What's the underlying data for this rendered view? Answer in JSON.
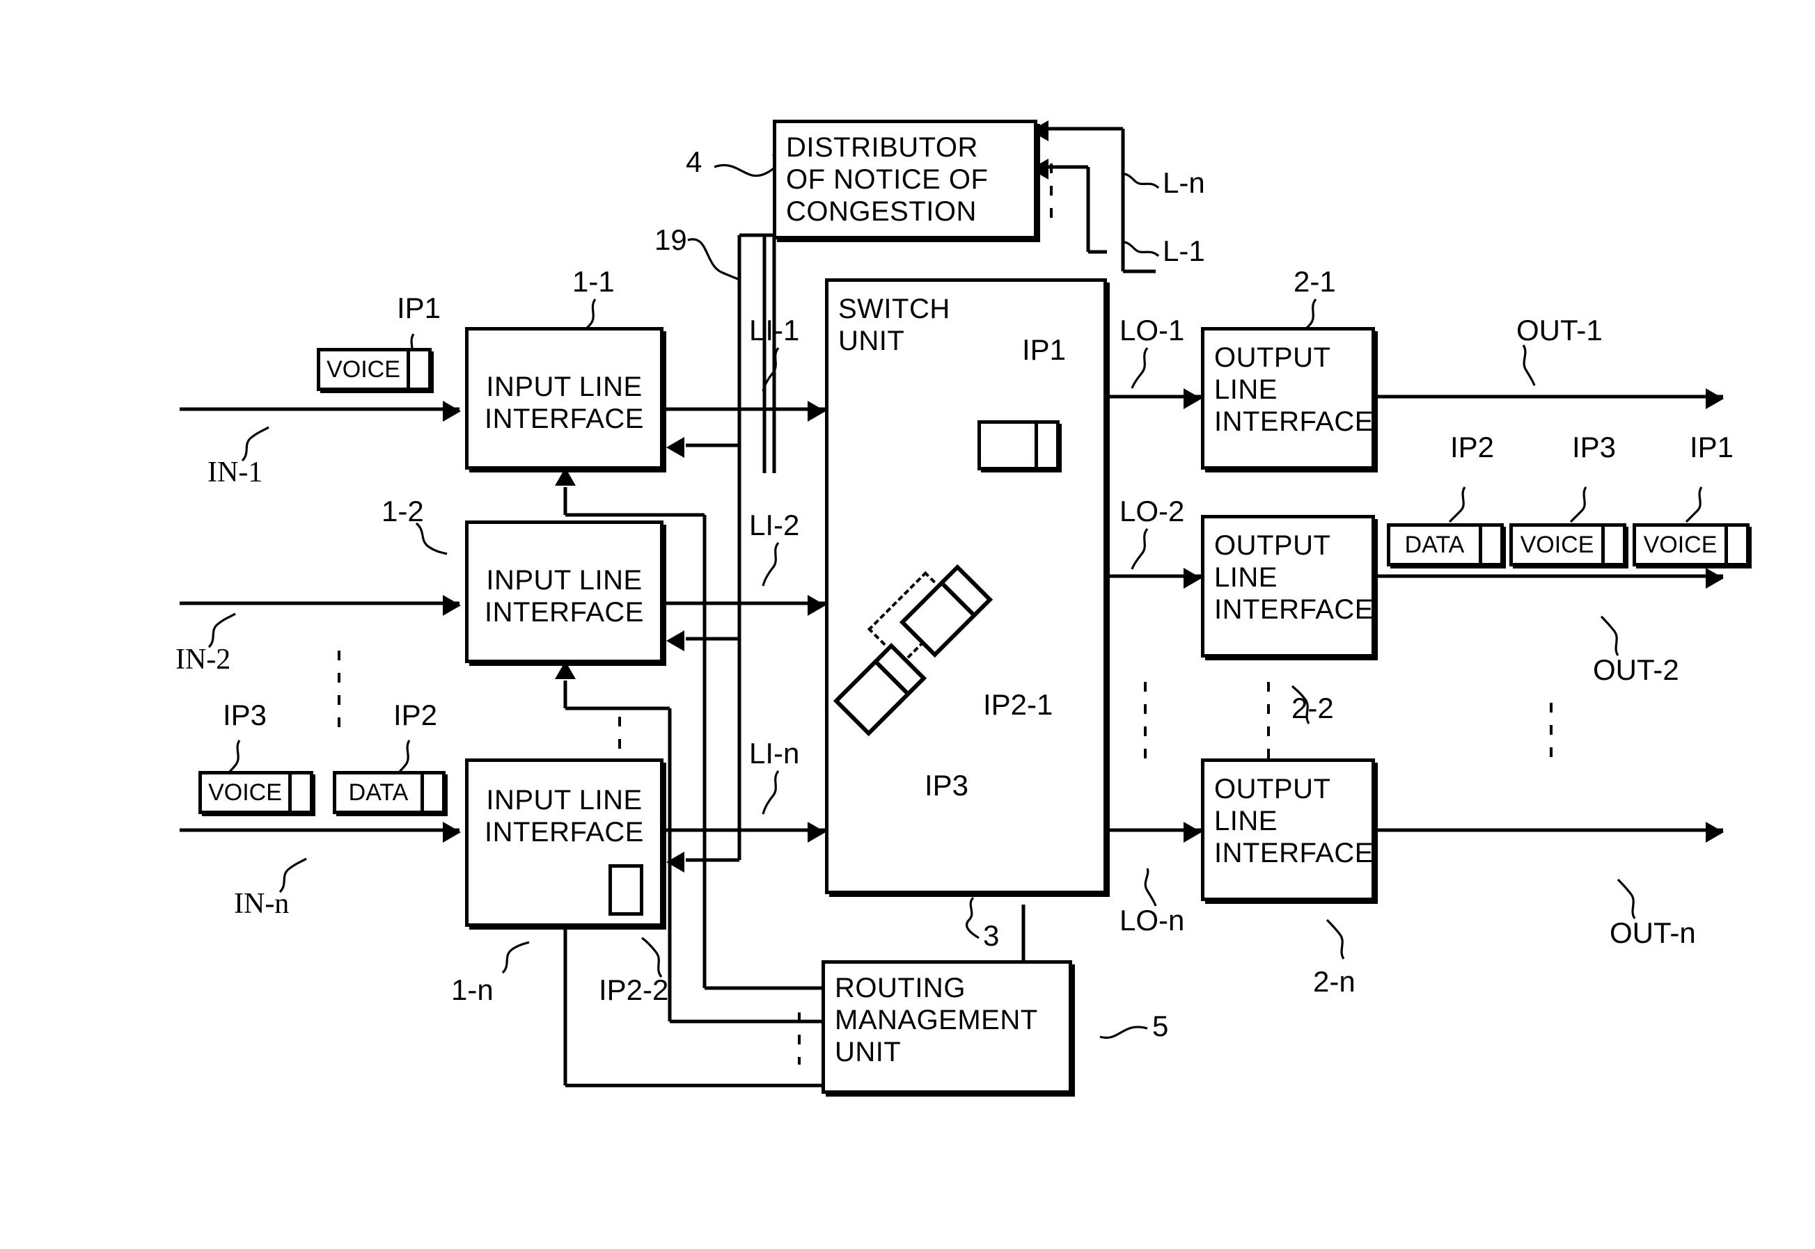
{
  "figure": {
    "title": "Packet switch block diagram with congestion notice distribution",
    "type": "block-diagram"
  },
  "blocks": {
    "distributor": {
      "ref": "4",
      "lines": [
        "DISTRIBUTOR",
        "OF NOTICE OF",
        "CONGESTION"
      ]
    },
    "switch_unit": {
      "ref": "3",
      "lines": [
        "SWITCH",
        "UNIT"
      ]
    },
    "routing_unit": {
      "ref": "5",
      "lines": [
        "ROUTING",
        "MANAGEMENT",
        "UNIT"
      ]
    },
    "input_interfaces": [
      {
        "ref": "1-1",
        "lines": [
          "INPUT LINE",
          "INTERFACE"
        ]
      },
      {
        "ref": "1-2",
        "lines": [
          "INPUT LINE",
          "INTERFACE"
        ]
      },
      {
        "ref": "1-n",
        "lines": [
          "INPUT LINE",
          "INTERFACE"
        ]
      }
    ],
    "output_interfaces": [
      {
        "ref": "2-1",
        "lines": [
          "OUTPUT",
          "LINE",
          "INTERFACE"
        ]
      },
      {
        "ref": "2-2",
        "lines": [
          "OUTPUT",
          "LINE",
          "INTERFACE"
        ]
      },
      {
        "ref": "2-n",
        "lines": [
          "OUTPUT",
          "LINE",
          "INTERFACE"
        ]
      }
    ]
  },
  "packets": {
    "in1": {
      "label": "IP1",
      "payload": "VOICE"
    },
    "inn_voice": {
      "label": "IP3",
      "payload": "VOICE"
    },
    "inn_data": {
      "label": "IP2",
      "payload": "DATA"
    },
    "out2_data": {
      "label": "IP2",
      "payload": "DATA"
    },
    "out2_voice1": {
      "label": "IP3",
      "payload": "VOICE"
    },
    "out2_voice2": {
      "label": "IP1",
      "payload": "VOICE"
    },
    "switch_ip1": {
      "label": "IP1"
    },
    "switch_ip2_1": {
      "label": "IP2-1"
    },
    "switch_ip3": {
      "label": "IP3"
    },
    "buffered_ip2_2": {
      "label": "IP2-2"
    }
  },
  "labels": {
    "input_lines": [
      "IN-1",
      "IN-2",
      "IN-n"
    ],
    "output_lines": [
      "OUT-1",
      "OUT-2",
      "OUT-n"
    ],
    "switch_in": [
      "LI-1",
      "LI-2",
      "LI-n"
    ],
    "switch_out": [
      "LO-1",
      "LO-2",
      "LO-n"
    ],
    "congestion_lines": [
      "L-n",
      "L-1"
    ],
    "notice_path_ref": "19"
  },
  "colors": {
    "ink": "#000000",
    "paper": "#ffffff"
  }
}
